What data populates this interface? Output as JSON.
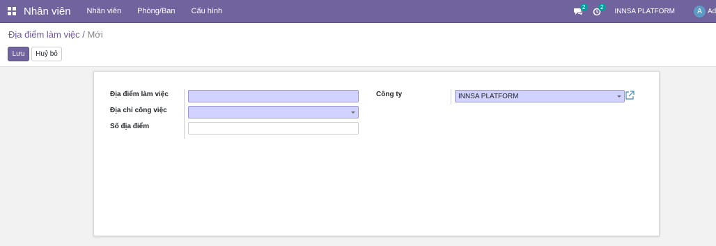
{
  "navbar": {
    "brand": "Nhân viên",
    "menu": [
      "Nhân viên",
      "Phòng/Ban",
      "Cấu hình"
    ],
    "messages_badge": "2",
    "activities_badge": "2",
    "company": "INNSA PLATFORM",
    "avatar_letter": "A",
    "user": "Administrator",
    "color": "#71639e"
  },
  "breadcrumb": {
    "parent": "Địa điểm làm việc",
    "separator": " / ",
    "current": "Mới"
  },
  "buttons": {
    "save": "Lưu",
    "discard": "Huỷ bỏ"
  },
  "form": {
    "work_location_label": "Địa điểm làm việc",
    "work_location_value": "",
    "work_address_label": "Địa chỉ công việc",
    "work_address_value": "",
    "location_number_label": "Số địa điểm",
    "location_number_value": "",
    "company_label": "Công ty",
    "company_value": "INNSA PLATFORM"
  }
}
